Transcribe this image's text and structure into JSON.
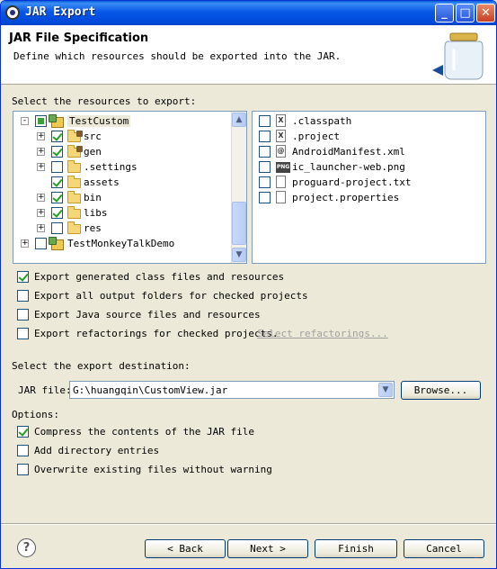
{
  "window": {
    "title": "JAR Export"
  },
  "header": {
    "title": "JAR File Specification",
    "description": "Define which resources should be exported into the JAR."
  },
  "resources_label": "Select the resources to export:",
  "tree": [
    {
      "label": "TestCustom",
      "state": "partial",
      "icon": "project-icon",
      "expander": "-"
    },
    {
      "label": "src",
      "state": "checked",
      "icon": "package-folder-icon",
      "expander": "+"
    },
    {
      "label": "gen",
      "state": "checked",
      "icon": "package-folder-icon",
      "expander": "+"
    },
    {
      "label": ".settings",
      "state": "unchecked",
      "icon": "folder-icon",
      "expander": "+"
    },
    {
      "label": "assets",
      "state": "checked",
      "icon": "folder-icon",
      "expander": ""
    },
    {
      "label": "bin",
      "state": "checked",
      "icon": "folder-icon",
      "expander": "+"
    },
    {
      "label": "libs",
      "state": "checked",
      "icon": "folder-icon",
      "expander": "+"
    },
    {
      "label": "res",
      "state": "unchecked",
      "icon": "folder-icon",
      "expander": "+"
    },
    {
      "label": "TestMonkeyTalkDemo",
      "state": "unchecked",
      "icon": "project-icon",
      "expander": "+"
    }
  ],
  "files": [
    {
      "label": ".classpath",
      "state": "unchecked",
      "icon": "xml-file-icon",
      "glyph": "X"
    },
    {
      "label": ".project",
      "state": "unchecked",
      "icon": "xml-file-icon",
      "glyph": "X"
    },
    {
      "label": "AndroidManifest.xml",
      "state": "unchecked",
      "icon": "manifest-file-icon",
      "glyph": "@"
    },
    {
      "label": "ic_launcher-web.png",
      "state": "unchecked",
      "icon": "png-file-icon",
      "glyph": "PNG"
    },
    {
      "label": "proguard-project.txt",
      "state": "unchecked",
      "icon": "text-file-icon",
      "glyph": ""
    },
    {
      "label": "project.properties",
      "state": "unchecked",
      "icon": "text-file-icon",
      "glyph": ""
    }
  ],
  "export_options": [
    {
      "label": "Export generated class files and resources",
      "checked": true
    },
    {
      "label": "Export all output folders for checked projects",
      "checked": false
    },
    {
      "label": "Export Java source files and resources",
      "checked": false
    },
    {
      "label": "Export refactorings for checked projects.",
      "checked": false
    }
  ],
  "select_refactorings_link": "Select refactorings...",
  "destination_label": "Select the export destination:",
  "jar_file": {
    "label": "JAR file:",
    "value": "G:\\huangqin\\CustomView.jar",
    "browse": "Browse..."
  },
  "options_label": "Options:",
  "options": [
    {
      "label": "Compress the contents of the JAR file",
      "checked": true
    },
    {
      "label": "Add directory entries",
      "checked": false
    },
    {
      "label": "Overwrite existing files without warning",
      "checked": false
    }
  ],
  "buttons": {
    "back": "< Back",
    "next": "Next >",
    "finish": "Finish",
    "cancel": "Cancel"
  },
  "colors": {
    "title_bar": "#0757e6",
    "dialog_bg": "#ece9d8",
    "check_green": "#21a121"
  }
}
